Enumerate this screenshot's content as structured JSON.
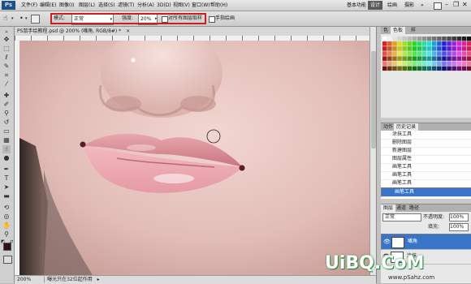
{
  "app": {
    "logo": "Ps"
  },
  "menubar": {
    "items": [
      "文件(F)",
      "编辑(E)",
      "图像(I)",
      "图层(L)",
      "选择(S)",
      "滤镜(T)",
      "分析(A)",
      "3D(D)",
      "视图(V)",
      "窗口(W)",
      "帮助(H)"
    ],
    "workspaces": [
      "基本功能",
      "设计",
      "绘画",
      "摄影"
    ],
    "active_workspace": "设计",
    "more": "»"
  },
  "options": {
    "mode_label": "模式:",
    "mode_value": "正常",
    "strength_label": "强度:",
    "strength_value": "20%",
    "sample_all_label": "对所有图层取样",
    "finger_paint_label": "手指绘画"
  },
  "document": {
    "tab_title": "PS鼠手绘教程.psd @ 200% (嘴角, RGB/8#) *",
    "zoom": "200%",
    "status": "曝光只在32位起作用"
  },
  "panels": {
    "swatch_tabs": [
      "色",
      "色板",
      "样"
    ],
    "history_tabs": [
      "动作",
      "历史记录"
    ],
    "history": [
      "涂抹工具",
      "删除图层",
      "新建图层",
      "图层属性",
      "画笔工具",
      "画笔工具",
      "画笔工具",
      "画笔工具"
    ],
    "layers_tabs": [
      "图层",
      "通道",
      "路径"
    ],
    "blend_mode": "正常",
    "opacity_label": "不透明度:",
    "opacity_value": "100%",
    "fill_label": "填充:",
    "fill_value": "100%",
    "layers": [
      "嘴角",
      "涂抹"
    ]
  },
  "watermark": {
    "brand": "UiBQ.CoM",
    "url": "www.pSahz.com"
  },
  "colors": {
    "foreground": "#2a1414",
    "background": "#6b1a1a",
    "highlight": "#cc1e1e",
    "selection": "#3875c9"
  }
}
